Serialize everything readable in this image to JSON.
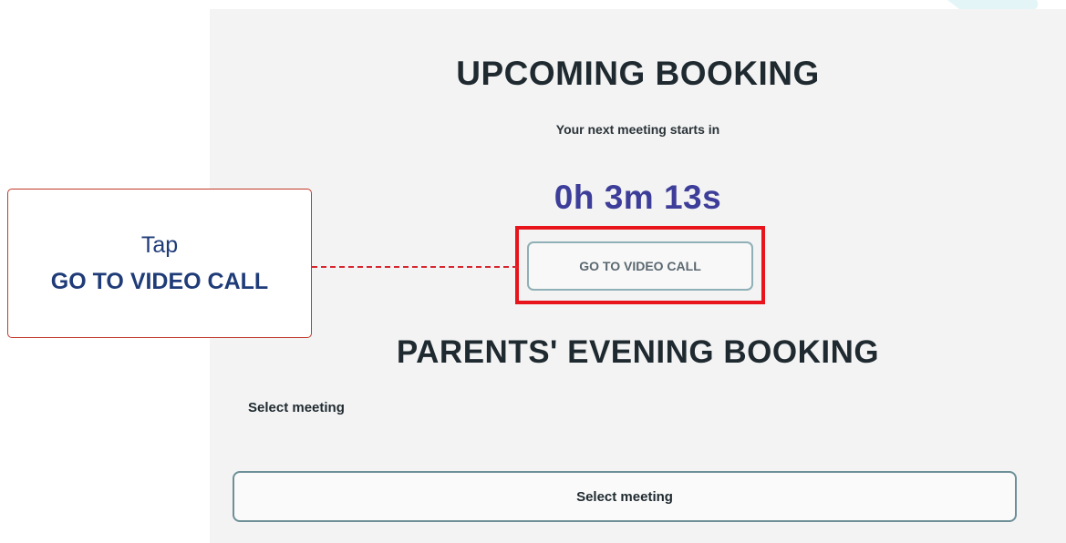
{
  "upcoming": {
    "heading": "UPCOMING BOOKING",
    "subtitle": "Your next meeting starts in",
    "countdown": "0h 3m 13s",
    "video_call_label": "GO TO VIDEO CALL"
  },
  "booking": {
    "heading": "PARENTS' EVENING BOOKING",
    "select_label": "Select meeting",
    "select_button_label": "Select meeting"
  },
  "callout": {
    "line1": "Tap",
    "line2": "GO TO VIDEO CALL"
  },
  "colors": {
    "countdown": "#3d3d9a",
    "highlight": "#e8141b",
    "callout_text": "#1f3c78",
    "panel_background": "#f3f3f3"
  }
}
